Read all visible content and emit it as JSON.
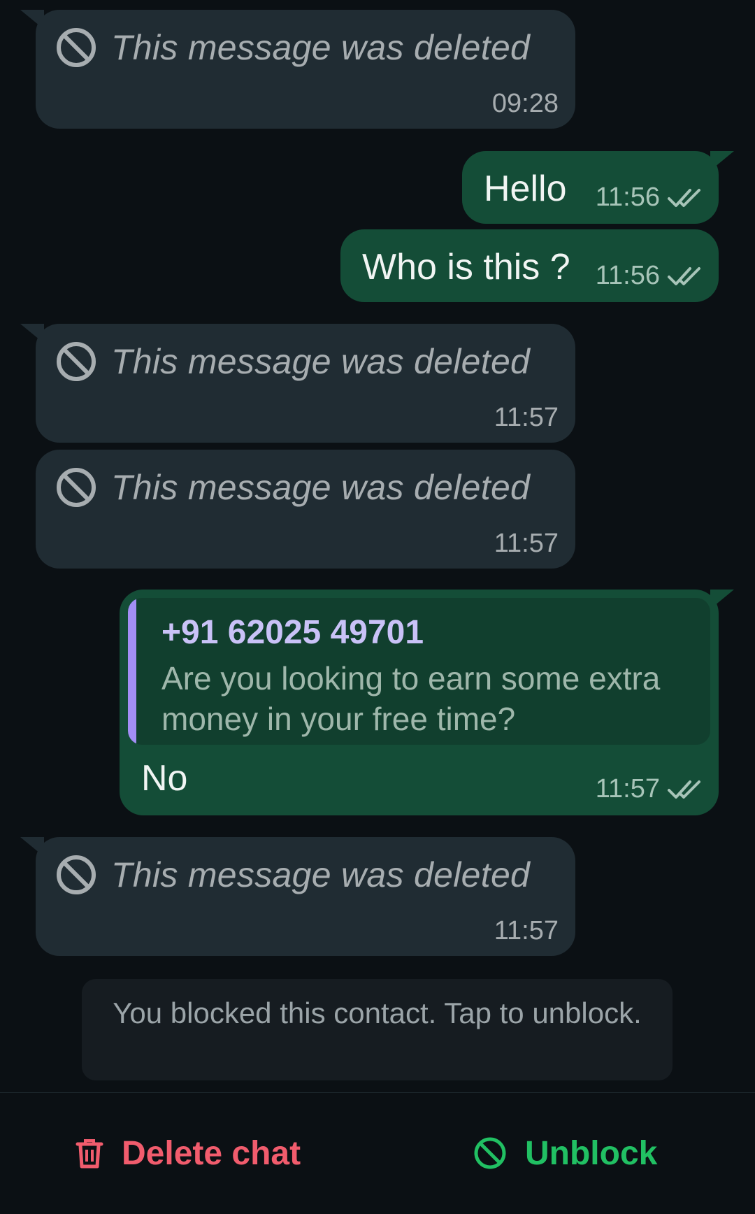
{
  "messages": [
    {
      "type": "deleted",
      "text": "This message was deleted",
      "time": "09:28"
    },
    {
      "type": "outgoing",
      "text": "Hello",
      "time": "11:56",
      "status": "read"
    },
    {
      "type": "outgoing",
      "text": "Who is this ?",
      "time": "11:56",
      "status": "read"
    },
    {
      "type": "deleted",
      "text": "This message was deleted",
      "time": "11:57"
    },
    {
      "type": "deleted",
      "text": "This message was deleted",
      "time": "11:57"
    },
    {
      "type": "reply",
      "quoted_sender": "+91 62025 49701",
      "quoted_text": "Are you looking to earn some extra money in your free time?",
      "text": "No",
      "time": "11:57",
      "status": "read"
    },
    {
      "type": "deleted",
      "text": "This message was deleted",
      "time": "11:57"
    }
  ],
  "notice": "You blocked this contact. Tap to unblock.",
  "actions": {
    "delete_label": "Delete chat",
    "unblock_label": "Unblock"
  },
  "colors": {
    "background": "#0b1014",
    "incoming_bubble": "#202c33",
    "outgoing_bubble": "#144d37",
    "delete_red": "#f15c6d",
    "unblock_green": "#21c063",
    "quote_bar": "#a38ef5"
  },
  "icons": {
    "deleted": "blocked-circle-icon",
    "read_receipt": "double-check-icon",
    "delete": "trash-icon",
    "unblock": "blocked-circle-icon"
  }
}
